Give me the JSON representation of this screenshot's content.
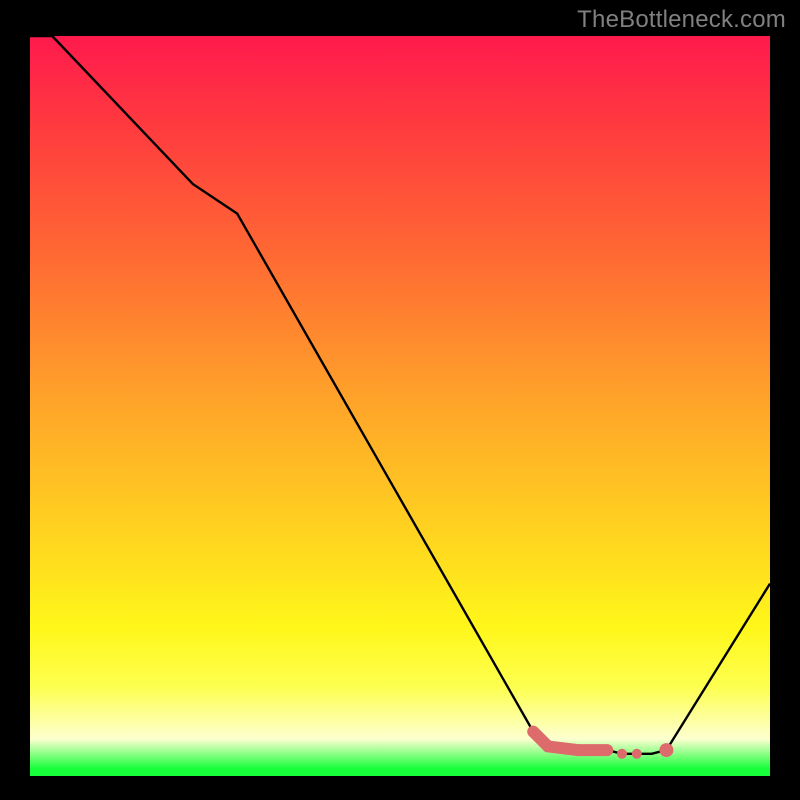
{
  "watermark": "TheBottleneck.com",
  "chart_data": {
    "type": "line",
    "title": "",
    "xlabel": "",
    "ylabel": "",
    "xlim": [
      0,
      100
    ],
    "ylim": [
      0,
      100
    ],
    "x": [
      0,
      3,
      22,
      28,
      68,
      70,
      74,
      78,
      80,
      82,
      84,
      86,
      100
    ],
    "values": [
      100,
      100,
      80,
      76,
      6,
      4,
      3.5,
      3.5,
      3,
      3,
      3,
      3.5,
      26
    ],
    "curve_color": "#000000",
    "annotations": [
      {
        "kind": "thick_segment",
        "x0": 68,
        "y0": 6,
        "x1": 70,
        "y1": 4,
        "color": "#de6b6b",
        "width": 12
      },
      {
        "kind": "thick_segment",
        "x0": 70,
        "y0": 4,
        "x1": 74,
        "y1": 3.5,
        "color": "#de6b6b",
        "width": 12
      },
      {
        "kind": "thick_segment",
        "x0": 74,
        "y0": 3.5,
        "x1": 78,
        "y1": 3.5,
        "color": "#de6b6b",
        "width": 12
      },
      {
        "kind": "dot",
        "x": 80,
        "y": 3,
        "r": 5,
        "color": "#de6b6b"
      },
      {
        "kind": "dot",
        "x": 82,
        "y": 3,
        "r": 5,
        "color": "#de6b6b"
      },
      {
        "kind": "dot",
        "x": 86,
        "y": 3.5,
        "r": 7,
        "color": "#de6b6b"
      }
    ],
    "gradient_stops": [
      {
        "pos": 0,
        "color": "#ff1a4d"
      },
      {
        "pos": 12,
        "color": "#ff3a3f"
      },
      {
        "pos": 30,
        "color": "#ff6a33"
      },
      {
        "pos": 48,
        "color": "#ffa02a"
      },
      {
        "pos": 66,
        "color": "#ffd020"
      },
      {
        "pos": 80,
        "color": "#fff71a"
      },
      {
        "pos": 88,
        "color": "#fdff50"
      },
      {
        "pos": 95,
        "color": "#fdffd0"
      },
      {
        "pos": 99,
        "color": "#17ff3a"
      },
      {
        "pos": 100,
        "color": "#17ff3a"
      }
    ]
  }
}
